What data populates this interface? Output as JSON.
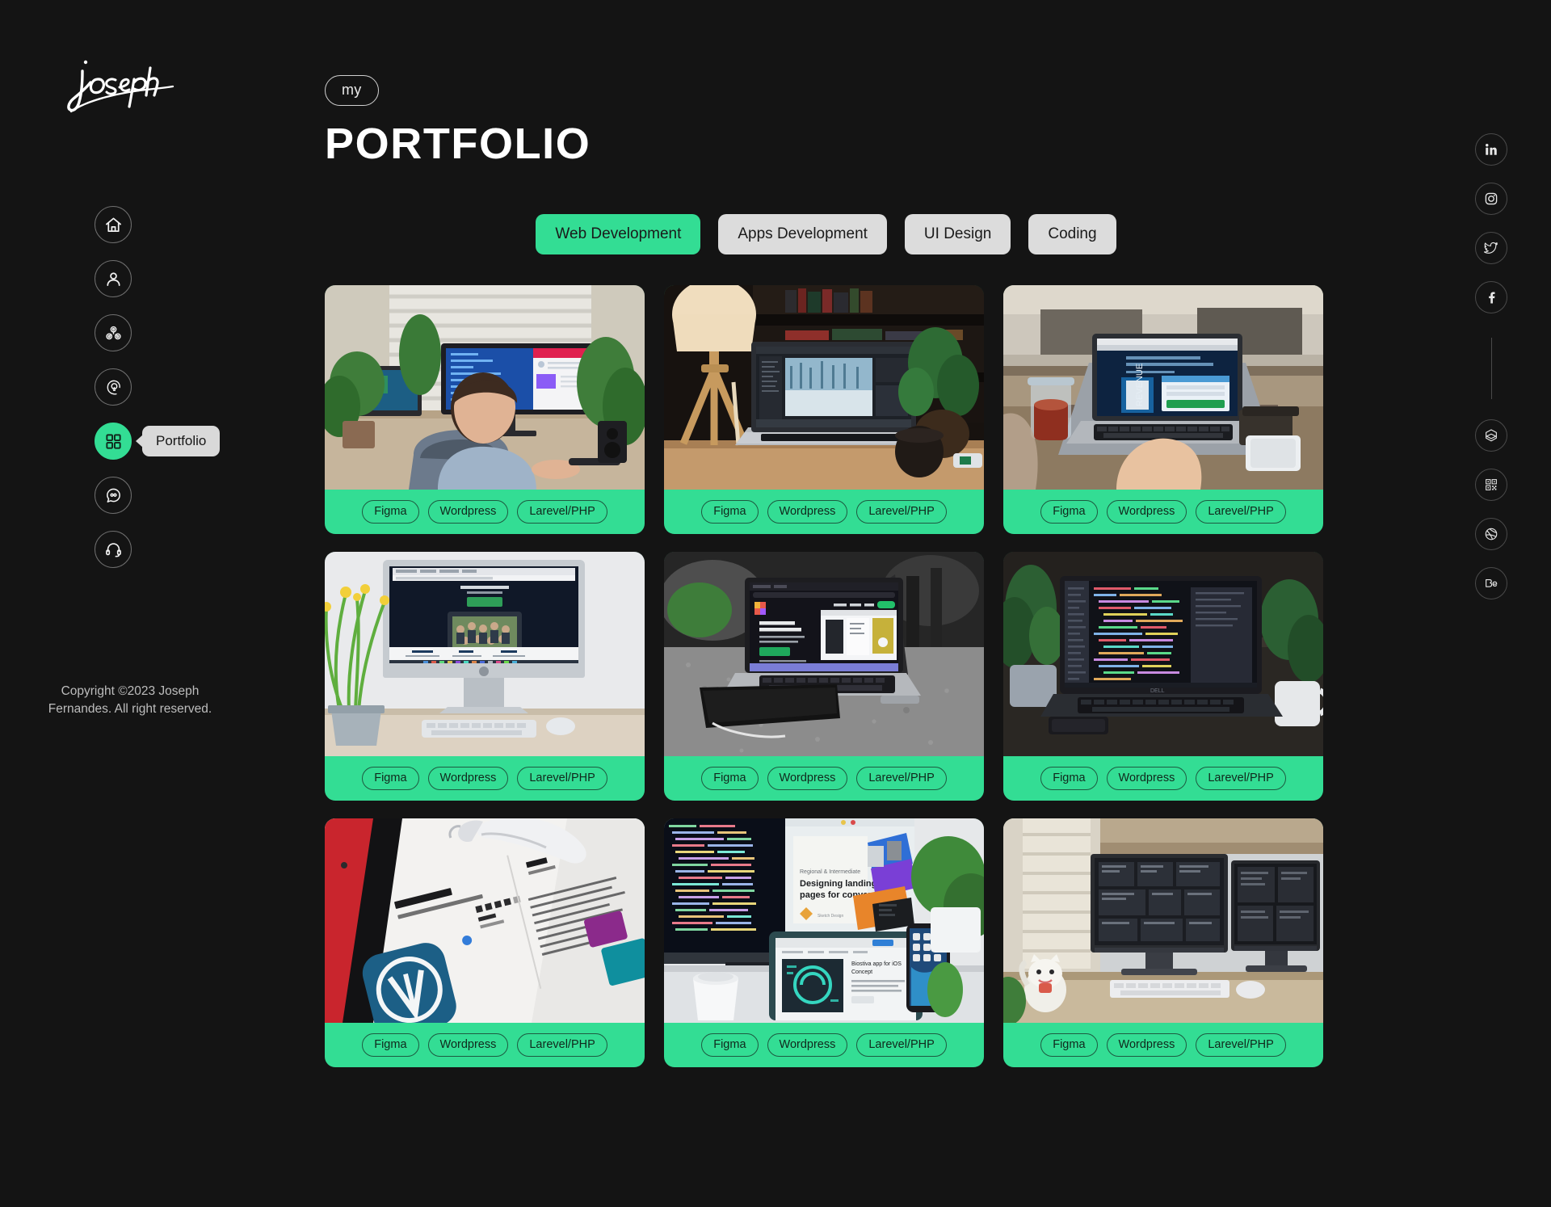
{
  "theme": {
    "background": "#141414",
    "accent": "#33dd94",
    "chip_inactive": "#dcdcdc",
    "text_light": "#ffffff"
  },
  "sidebar": {
    "logo_text": "joseph",
    "nav": [
      {
        "label": "Home",
        "icon": "home-icon",
        "active": false
      },
      {
        "label": "About",
        "icon": "user-icon",
        "active": false
      },
      {
        "label": "Services",
        "icon": "gears-icon",
        "active": false
      },
      {
        "label": "Resume",
        "icon": "head-idea-icon",
        "active": false
      },
      {
        "label": "Portfolio",
        "icon": "grid-icon",
        "active": true
      },
      {
        "label": "Testimonials",
        "icon": "chat-bubble-icon",
        "active": false
      },
      {
        "label": "Contact",
        "icon": "headset-icon",
        "active": false
      }
    ],
    "active_tooltip": "Portfolio",
    "copyright_line1": "Copyright ©2023 Joseph",
    "copyright_line2": "Fernandes. All right reserved."
  },
  "header": {
    "badge": "my",
    "title": "PORTFOLIO"
  },
  "filters": [
    {
      "label": "Web Development",
      "active": true
    },
    {
      "label": "Apps Development",
      "active": false
    },
    {
      "label": "UI Design",
      "active": false
    },
    {
      "label": "Coding",
      "active": false
    }
  ],
  "projects": [
    {
      "image_alt": "Man at desk working on ultrawide monitor with code and website",
      "tags": [
        "Figma",
        "Wordpress",
        "Larevel/PHP"
      ]
    },
    {
      "image_alt": "Laptop with photo editing software on desk with lamp and plant",
      "tags": [
        "Figma",
        "Wordpress",
        "Larevel/PHP"
      ]
    },
    {
      "image_alt": "Hands typing on laptop showing revenue landing page with iced coffee",
      "tags": [
        "Figma",
        "Wordpress",
        "Larevel/PHP"
      ]
    },
    {
      "image_alt": "iMac on wooden desk displaying social app page with daffodils",
      "tags": [
        "Figma",
        "Wordpress",
        "Larevel/PHP"
      ]
    },
    {
      "image_alt": "Laptop on granite counter showing Figma product website",
      "tags": [
        "Figma",
        "Wordpress",
        "Larevel/PHP"
      ]
    },
    {
      "image_alt": "Laptop with code editor on desk with mug and plant",
      "tags": [
        "Figma",
        "Wordpress",
        "Larevel/PHP"
      ]
    },
    {
      "image_alt": "Tablet showing WordPress app store listing with stylus",
      "tags": [
        "Figma",
        "Wordpress",
        "Larevel/PHP"
      ]
    },
    {
      "image_alt": "Monitor with code and landing page design, tablet and phone on desk",
      "tags": [
        "Figma",
        "Wordpress",
        "Larevel/PHP"
      ]
    },
    {
      "image_alt": "Dual monitor setup with design mockups near a window",
      "tags": [
        "Figma",
        "Wordpress",
        "Larevel/PHP"
      ]
    }
  ],
  "social_rail": {
    "top": [
      {
        "label": "LinkedIn",
        "icon": "linkedin-icon"
      },
      {
        "label": "Instagram",
        "icon": "instagram-icon"
      },
      {
        "label": "Twitter",
        "icon": "twitter-icon"
      },
      {
        "label": "Facebook",
        "icon": "facebook-icon"
      }
    ],
    "bottom": [
      {
        "label": "Layers",
        "icon": "hexagon-layers-icon"
      },
      {
        "label": "QR Code",
        "icon": "qr-code-icon"
      },
      {
        "label": "Dribbble",
        "icon": "dribbble-icon"
      },
      {
        "label": "Behance",
        "icon": "behance-icon"
      }
    ]
  }
}
